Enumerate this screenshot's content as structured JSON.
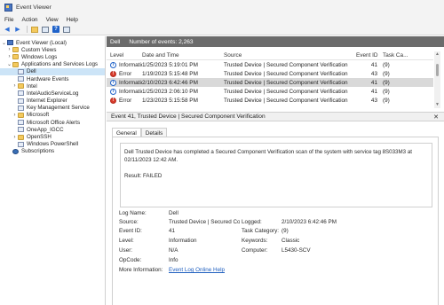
{
  "window": {
    "title": "Event Viewer"
  },
  "menu": [
    "File",
    "Action",
    "View",
    "Help"
  ],
  "tree": [
    {
      "label": "Event Viewer (Local)",
      "chev": "⌄",
      "icon": "ev",
      "indent": 0
    },
    {
      "label": "Custom Views",
      "chev": "›",
      "icon": "folder",
      "indent": 1
    },
    {
      "label": "Windows Logs",
      "chev": "›",
      "icon": "folder",
      "indent": 1
    },
    {
      "label": "Applications and Services Logs",
      "chev": "⌄",
      "icon": "folder",
      "indent": 1
    },
    {
      "label": "Dell",
      "chev": "",
      "icon": "log",
      "indent": 2,
      "selected": true
    },
    {
      "label": "Hardware Events",
      "chev": "",
      "icon": "log",
      "indent": 2
    },
    {
      "label": "Intel",
      "chev": "›",
      "icon": "folder",
      "indent": 2
    },
    {
      "label": "IntelAudioServiceLog",
      "chev": "",
      "icon": "log",
      "indent": 2
    },
    {
      "label": "Internet Explorer",
      "chev": "",
      "icon": "log",
      "indent": 2
    },
    {
      "label": "Key Management Service",
      "chev": "",
      "icon": "log",
      "indent": 2
    },
    {
      "label": "Microsoft",
      "chev": "›",
      "icon": "folder",
      "indent": 2
    },
    {
      "label": "Microsoft Office Alerts",
      "chev": "",
      "icon": "log",
      "indent": 2
    },
    {
      "label": "OneApp_IGCC",
      "chev": "",
      "icon": "log",
      "indent": 2
    },
    {
      "label": "OpenSSH",
      "chev": "›",
      "icon": "folder",
      "indent": 2
    },
    {
      "label": "Windows PowerShell",
      "chev": "",
      "icon": "log",
      "indent": 2
    },
    {
      "label": "Subscriptions",
      "chev": "",
      "icon": "sub",
      "indent": 1
    }
  ],
  "pane": {
    "log_name": "Dell",
    "event_count": "Number of events: 2,263"
  },
  "columns": {
    "level": "Level",
    "date": "Date and Time",
    "source": "Source",
    "id": "Event ID",
    "task": "Task Ca..."
  },
  "events": [
    {
      "level": "Information",
      "type": "info",
      "date": "1/25/2023 5:19:01 PM",
      "source": "Trusted Device | Secured Component Verification",
      "id": "41",
      "task": "(9)"
    },
    {
      "level": "Error",
      "type": "error",
      "date": "1/19/2023 5:15:48 PM",
      "source": "Trusted Device | Secured Component Verification",
      "id": "43",
      "task": "(9)"
    },
    {
      "level": "Information",
      "type": "info",
      "date": "2/10/2023 6:42:46 PM",
      "source": "Trusted Device | Secured Component Verification",
      "id": "41",
      "task": "(9)",
      "selected": true
    },
    {
      "level": "Information",
      "type": "info",
      "date": "1/25/2023 2:06:10 PM",
      "source": "Trusted Device | Secured Component Verification",
      "id": "41",
      "task": "(9)"
    },
    {
      "level": "Error",
      "type": "error",
      "date": "1/23/2023 5:15:58 PM",
      "source": "Trusted Device | Secured Component Verification",
      "id": "43",
      "task": "(9)"
    }
  ],
  "detail": {
    "header": "Event 41, Trusted Device | Secured Component Verification",
    "tabs": [
      "General",
      "Details"
    ],
    "description_line1": "Dell Trusted Device has completed a Secured Component Verification scan of the system with service tag 8S033M3 at 02/11/2023 12:42 AM.",
    "description_line2": "Result: FAILED",
    "labels": {
      "log_name": "Log Name:",
      "source": "Source:",
      "event_id": "Event ID:",
      "level": "Level:",
      "user": "User:",
      "opcode": "OpCode:",
      "more_info": "More Information:",
      "logged": "Logged:",
      "task_category": "Task Category:",
      "keywords": "Keywords:",
      "computer": "Computer:"
    },
    "values": {
      "log_name": "Dell",
      "source": "Trusted Device | Secured Cor",
      "event_id": "41",
      "level": "Information",
      "user": "N/A",
      "opcode": "Info",
      "more_info": "Event Log Online Help",
      "logged": "2/10/2023 6:42:46 PM",
      "task_category": "(9)",
      "keywords": "Classic",
      "computer": "L5430-SCV"
    }
  }
}
